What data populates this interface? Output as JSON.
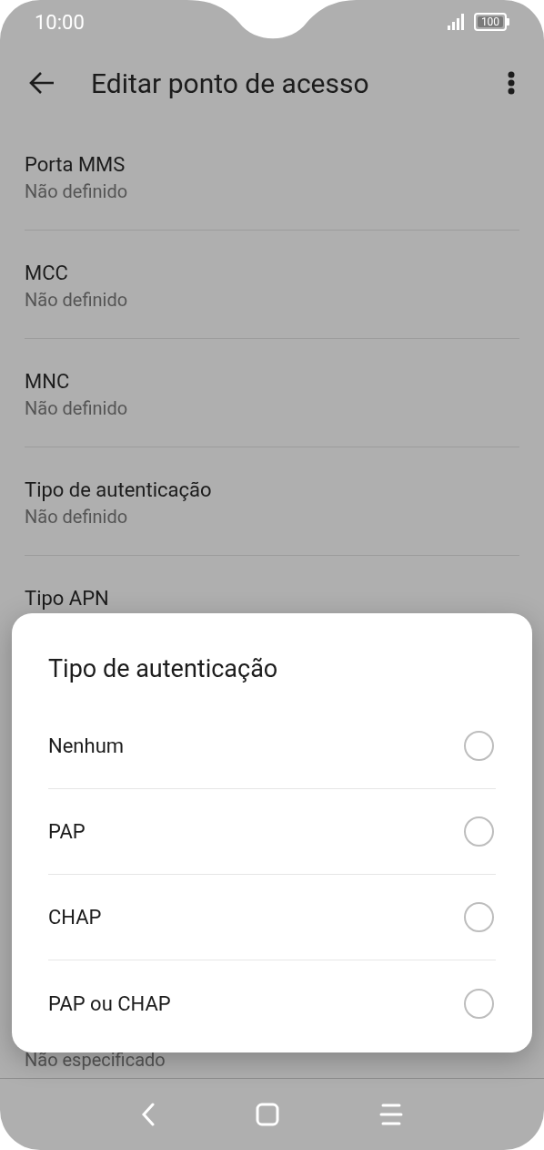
{
  "status_bar": {
    "time": "10:00",
    "battery": "100"
  },
  "header": {
    "title": "Editar ponto de acesso"
  },
  "settings": [
    {
      "title": "Porta MMS",
      "value": "Não definido"
    },
    {
      "title": "MCC",
      "value": "Não definido"
    },
    {
      "title": "MNC",
      "value": "Não definido"
    },
    {
      "title": "Tipo de autenticação",
      "value": "Não definido"
    },
    {
      "title": "Tipo APN"
    }
  ],
  "partial_item": {
    "value": "Não especificado"
  },
  "dialog": {
    "title": "Tipo de autenticação",
    "options": [
      {
        "label": "Nenhum",
        "selected": false
      },
      {
        "label": "PAP",
        "selected": false
      },
      {
        "label": "CHAP",
        "selected": false
      },
      {
        "label": "PAP ou CHAP",
        "selected": false
      }
    ]
  }
}
